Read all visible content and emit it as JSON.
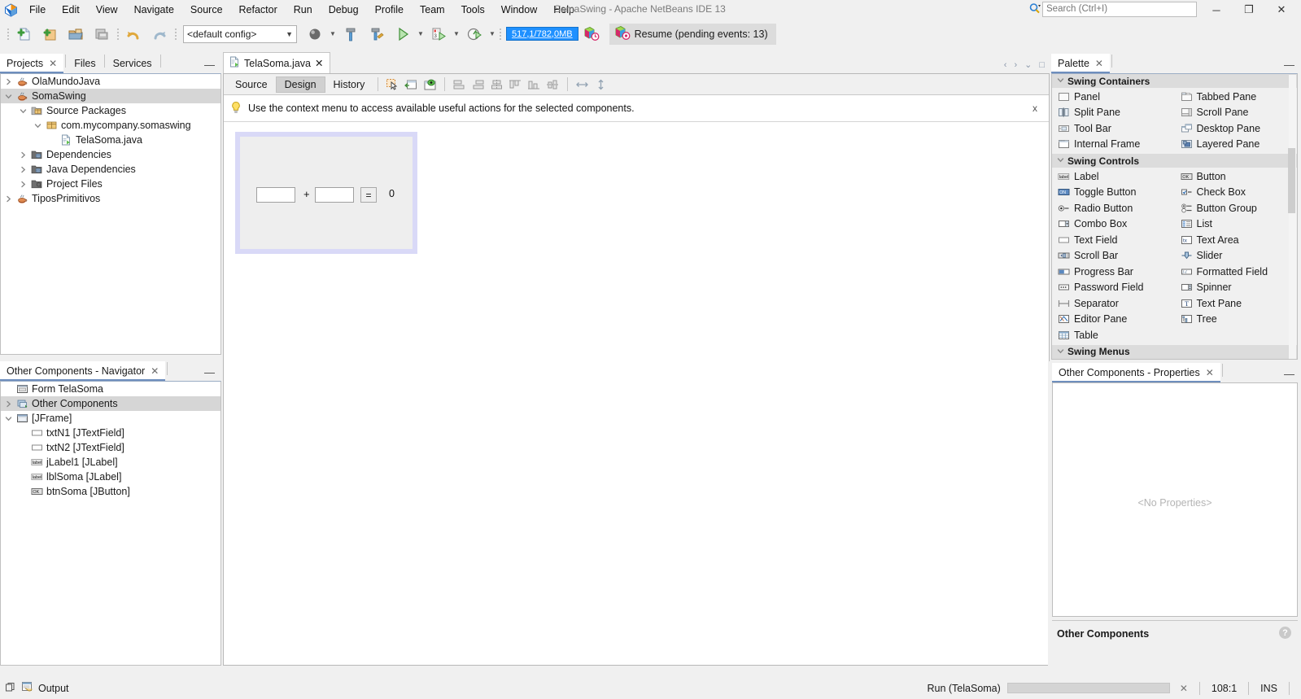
{
  "window": {
    "title": "SomaSwing - Apache NetBeans IDE 13",
    "minimize": "─",
    "maximize": "❐",
    "close": "✕"
  },
  "search": {
    "placeholder": "Search (Ctrl+I)",
    "value": ""
  },
  "menu": [
    "File",
    "Edit",
    "View",
    "Navigate",
    "Source",
    "Refactor",
    "Run",
    "Debug",
    "Profile",
    "Team",
    "Tools",
    "Window",
    "Help"
  ],
  "toolbar": {
    "config_value": "<default config>",
    "memory": "517,1/782,0MB",
    "resume_label": "Resume (pending events: 13)"
  },
  "projects_panel": {
    "tabs": [
      {
        "label": "Projects",
        "closable": true,
        "active": true
      },
      {
        "label": "Files",
        "closable": false,
        "active": false
      },
      {
        "label": "Services",
        "closable": false,
        "active": false
      }
    ],
    "close_glyph": "✕",
    "minimize_glyph": "—",
    "tree": [
      {
        "label": "OlaMundoJava",
        "indent": 0,
        "twist": "right",
        "icon": "java-project-icon",
        "selected": false
      },
      {
        "label": "SomaSwing",
        "indent": 0,
        "twist": "down",
        "icon": "java-project-icon",
        "selected": true
      },
      {
        "label": "Source Packages",
        "indent": 1,
        "twist": "down",
        "icon": "source-packages-icon",
        "selected": false
      },
      {
        "label": "com.mycompany.somaswing",
        "indent": 2,
        "twist": "down",
        "icon": "package-icon",
        "selected": false
      },
      {
        "label": "TelaSoma.java",
        "indent": 3,
        "twist": "none",
        "icon": "java-file-icon",
        "selected": false
      },
      {
        "label": "Dependencies",
        "indent": 1,
        "twist": "right",
        "icon": "dependencies-icon",
        "selected": false
      },
      {
        "label": "Java Dependencies",
        "indent": 1,
        "twist": "right",
        "icon": "dependencies-icon",
        "selected": false
      },
      {
        "label": "Project Files",
        "indent": 1,
        "twist": "right",
        "icon": "project-files-icon",
        "selected": false
      },
      {
        "label": "TiposPrimitivos",
        "indent": 0,
        "twist": "right",
        "icon": "java-project-icon",
        "selected": false
      }
    ]
  },
  "navigator_panel": {
    "tab_label": "Other Components - Navigator",
    "close_glyph": "✕",
    "minimize_glyph": "—",
    "tree": [
      {
        "label": "Form TelaSoma",
        "indent": 0,
        "twist": "none",
        "icon": "form-icon",
        "selected": false
      },
      {
        "label": "Other Components",
        "indent": 0,
        "twist": "right",
        "icon": "other-components-icon",
        "selected": true
      },
      {
        "label": "[JFrame]",
        "indent": 0,
        "twist": "down",
        "icon": "jframe-icon",
        "selected": false
      },
      {
        "label": "txtN1 [JTextField]",
        "indent": 1,
        "twist": "none",
        "icon": "textfield-icon",
        "selected": false
      },
      {
        "label": "txtN2 [JTextField]",
        "indent": 1,
        "twist": "none",
        "icon": "textfield-icon",
        "selected": false
      },
      {
        "label": "jLabel1 [JLabel]",
        "indent": 1,
        "twist": "none",
        "icon": "label-icon",
        "selected": false
      },
      {
        "label": "lblSoma [JLabel]",
        "indent": 1,
        "twist": "none",
        "icon": "label-icon",
        "selected": false
      },
      {
        "label": "btnSoma [JButton]",
        "indent": 1,
        "twist": "none",
        "icon": "button-icon",
        "selected": false
      }
    ]
  },
  "editor": {
    "tab_label": "TelaSoma.java",
    "tab_close_glyph": "✕",
    "views": [
      {
        "label": "Source",
        "active": false
      },
      {
        "label": "Design",
        "active": true
      },
      {
        "label": "History",
        "active": false
      }
    ],
    "nav_prev": "‹",
    "nav_next": "›",
    "nav_list": "⌄",
    "maximize_glyph": "□",
    "tip_text": "Use the context menu to access available useful actions for the selected components.",
    "tip_close": "x"
  },
  "form_design": {
    "field1_value": "",
    "field2_value": "",
    "plus_label": "+",
    "equals_label": "=",
    "result_label": "0",
    "selection_color": "#d9d9f7",
    "panel_color": "#eeeeee"
  },
  "palette": {
    "tab_label": "Palette",
    "close_glyph": "✕",
    "minimize_glyph": "—",
    "categories": [
      {
        "name": "Swing Containers",
        "expanded": true,
        "items": [
          {
            "label": "Panel",
            "icon": "panel-icon"
          },
          {
            "label": "Tabbed Pane",
            "icon": "tabbed-pane-icon"
          },
          {
            "label": "Split Pane",
            "icon": "split-pane-icon"
          },
          {
            "label": "Scroll Pane",
            "icon": "scroll-pane-icon"
          },
          {
            "label": "Tool Bar",
            "icon": "tool-bar-icon"
          },
          {
            "label": "Desktop Pane",
            "icon": "desktop-pane-icon"
          },
          {
            "label": "Internal Frame",
            "icon": "internal-frame-icon"
          },
          {
            "label": "Layered Pane",
            "icon": "layered-pane-icon"
          }
        ]
      },
      {
        "name": "Swing Controls",
        "expanded": true,
        "items": [
          {
            "label": "Label",
            "icon": "label-icon"
          },
          {
            "label": "Button",
            "icon": "button-icon"
          },
          {
            "label": "Toggle Button",
            "icon": "toggle-button-icon"
          },
          {
            "label": "Check Box",
            "icon": "check-box-icon"
          },
          {
            "label": "Radio Button",
            "icon": "radio-button-icon"
          },
          {
            "label": "Button Group",
            "icon": "button-group-icon"
          },
          {
            "label": "Combo Box",
            "icon": "combo-box-icon"
          },
          {
            "label": "List",
            "icon": "list-icon"
          },
          {
            "label": "Text Field",
            "icon": "text-field-icon"
          },
          {
            "label": "Text Area",
            "icon": "text-area-icon"
          },
          {
            "label": "Scroll Bar",
            "icon": "scroll-bar-icon"
          },
          {
            "label": "Slider",
            "icon": "slider-icon"
          },
          {
            "label": "Progress Bar",
            "icon": "progress-bar-icon"
          },
          {
            "label": "Formatted Field",
            "icon": "formatted-field-icon"
          },
          {
            "label": "Password Field",
            "icon": "password-field-icon"
          },
          {
            "label": "Spinner",
            "icon": "spinner-icon"
          },
          {
            "label": "Separator",
            "icon": "separator-icon"
          },
          {
            "label": "Text Pane",
            "icon": "text-pane-icon"
          },
          {
            "label": "Editor Pane",
            "icon": "editor-pane-icon"
          },
          {
            "label": "Tree",
            "icon": "tree-icon"
          },
          {
            "label": "Table",
            "icon": "table-icon"
          }
        ]
      },
      {
        "name": "Swing Menus",
        "expanded": true,
        "items": []
      }
    ]
  },
  "properties_panel": {
    "tab_label": "Other Components - Properties",
    "close_glyph": "✕",
    "minimize_glyph": "—",
    "empty_text": "<No Properties>",
    "footer_title": "Other Components",
    "help_glyph": "?"
  },
  "statusbar": {
    "output_label": "Output",
    "run_label": "Run (TelaSoma)",
    "progress_cancel": "✕",
    "caret_position": "108:1",
    "insert_mode": "INS"
  }
}
